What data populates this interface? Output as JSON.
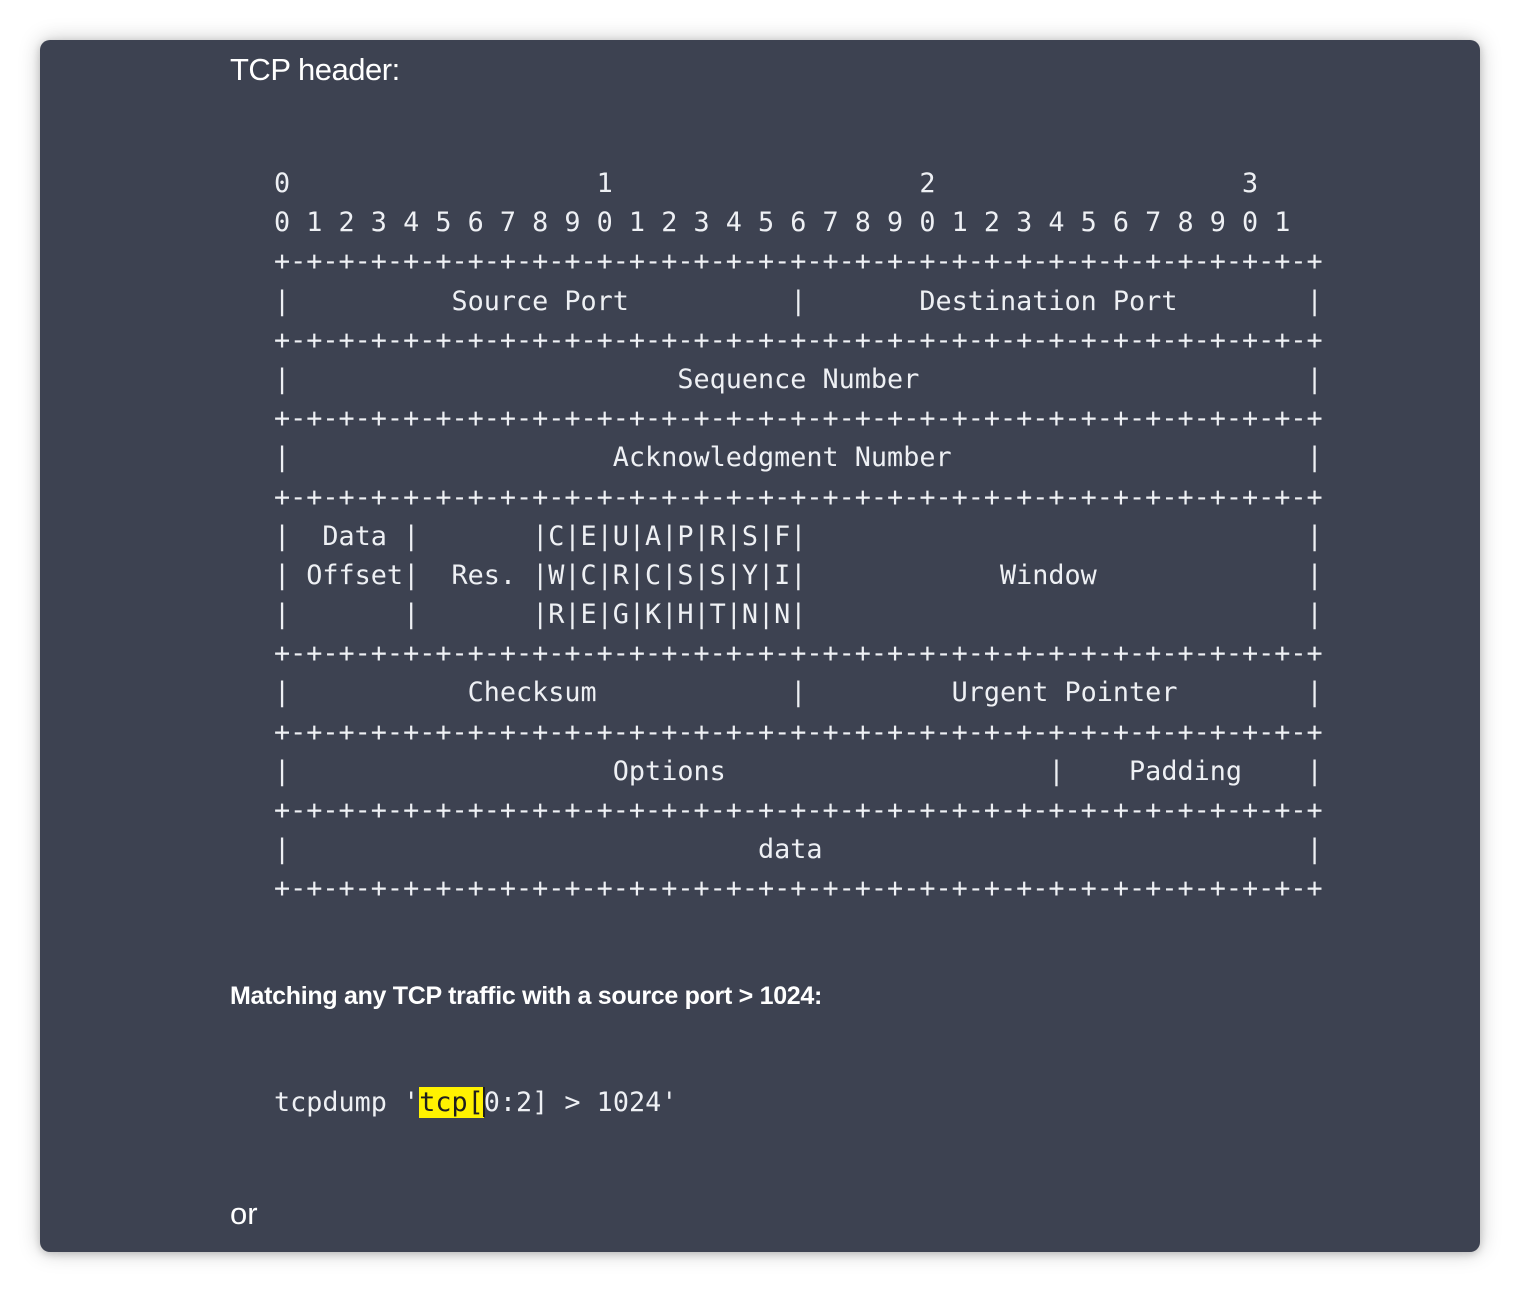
{
  "heading": "TCP header:",
  "diagram_lines": [
    "0                   1                   2                   3",
    "0 1 2 3 4 5 6 7 8 9 0 1 2 3 4 5 6 7 8 9 0 1 2 3 4 5 6 7 8 9 0 1",
    "+-+-+-+-+-+-+-+-+-+-+-+-+-+-+-+-+-+-+-+-+-+-+-+-+-+-+-+-+-+-+-+-+",
    "|          Source Port          |       Destination Port        |",
    "+-+-+-+-+-+-+-+-+-+-+-+-+-+-+-+-+-+-+-+-+-+-+-+-+-+-+-+-+-+-+-+-+",
    "|                        Sequence Number                        |",
    "+-+-+-+-+-+-+-+-+-+-+-+-+-+-+-+-+-+-+-+-+-+-+-+-+-+-+-+-+-+-+-+-+",
    "|                    Acknowledgment Number                      |",
    "+-+-+-+-+-+-+-+-+-+-+-+-+-+-+-+-+-+-+-+-+-+-+-+-+-+-+-+-+-+-+-+-+",
    "|  Data |       |C|E|U|A|P|R|S|F|                               |",
    "| Offset|  Res. |W|C|R|C|S|S|Y|I|            Window             |",
    "|       |       |R|E|G|K|H|T|N|N|                               |",
    "+-+-+-+-+-+-+-+-+-+-+-+-+-+-+-+-+-+-+-+-+-+-+-+-+-+-+-+-+-+-+-+-+",
    "|           Checksum            |         Urgent Pointer        |",
    "+-+-+-+-+-+-+-+-+-+-+-+-+-+-+-+-+-+-+-+-+-+-+-+-+-+-+-+-+-+-+-+-+",
    "|                    Options                    |    Padding    |",
    "+-+-+-+-+-+-+-+-+-+-+-+-+-+-+-+-+-+-+-+-+-+-+-+-+-+-+-+-+-+-+-+-+",
    "|                             data                              |",
    "+-+-+-+-+-+-+-+-+-+-+-+-+-+-+-+-+-+-+-+-+-+-+-+-+-+-+-+-+-+-+-+-+"
  ],
  "subheading": "Matching any TCP traffic with a source port > 1024:",
  "command": {
    "prefix": "tcpdump '",
    "highlight": "tcp[",
    "suffix": "0:2] > 1024'"
  },
  "trailing_text": "or",
  "colors": {
    "background": "#3d4251",
    "text": "#eef0f4",
    "highlight": "#fff200"
  }
}
